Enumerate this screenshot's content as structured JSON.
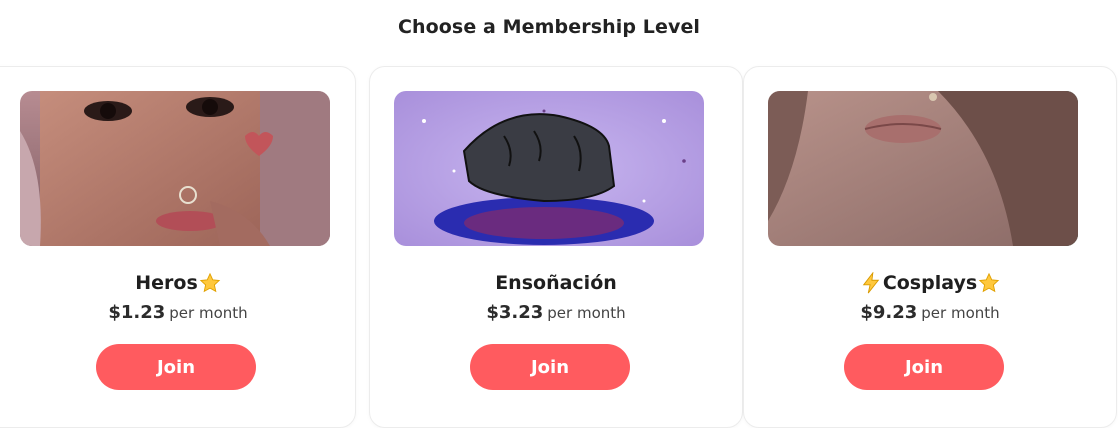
{
  "page": {
    "title": "Choose a Membership Level"
  },
  "tiers": [
    {
      "name": "Heros",
      "name_suffix_icon": "star-icon",
      "price": "$1.23",
      "period": "per month",
      "button": "Join"
    },
    {
      "name": "Ensoñación",
      "price": "$3.23",
      "period": "per month",
      "button": "Join"
    },
    {
      "name_prefix_icon": "lightning-icon",
      "name": "Cosplays",
      "name_suffix_icon": "star-icon",
      "price": "$9.23",
      "period": "per month",
      "button": "Join"
    }
  ],
  "colors": {
    "accent": "#ff5b5f",
    "card_border": "#ececec",
    "text": "#222222"
  }
}
